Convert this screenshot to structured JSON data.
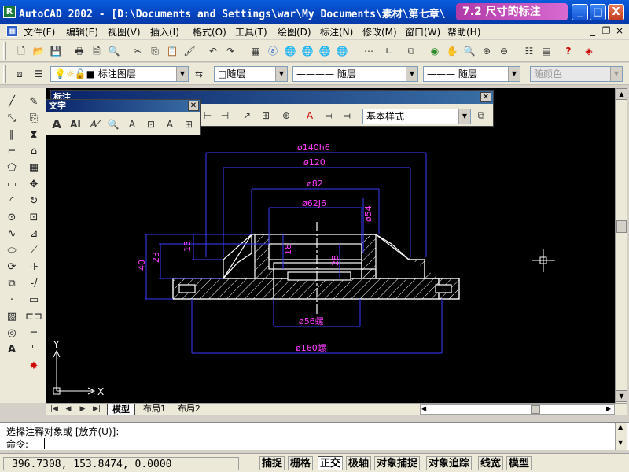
{
  "window": {
    "title": "AutoCAD 2002 - [D:\\Documents and Settings\\war\\My Documents\\素材\\第七章\\",
    "lesson_banner": "7.2 尺寸的标注",
    "app_icon": "R",
    "minimize": "_",
    "maximize": "□",
    "close": "X"
  },
  "menu": {
    "items": [
      "文件(F)",
      "编辑(E)",
      "视图(V)",
      "插入(I)",
      "格式(O)",
      "工具(T)",
      "绘图(D)",
      "标注(N)",
      "修改(M)",
      "窗口(W)",
      "帮助(H)"
    ],
    "mdi_min": "_",
    "mdi_restore": "❐",
    "mdi_close": "×"
  },
  "layer_bar": {
    "layer_name": "标注图层",
    "color": "□随层",
    "linetype": "———— 随层",
    "lineweight": "——— 随层",
    "plotstyle": "随颜色"
  },
  "dim_toolbar": {
    "title": "标注",
    "style": "基本样式"
  },
  "text_toolbar": {
    "title": "文字"
  },
  "drawing": {
    "dims": {
      "d140": "ø140h6",
      "d120": "ø120",
      "d82": "ø82",
      "d62": "ø62J6",
      "d54": "ø54",
      "d56": "ø56螺",
      "d160": "ø160螺",
      "h40": "40",
      "h23": "23",
      "h15": "15",
      "h18": "18",
      "h28": "28"
    },
    "ucs_x": "X",
    "ucs_y": "Y"
  },
  "tabs": [
    "模型",
    "布局1",
    "布局2"
  ],
  "command": {
    "history": "选择注释对象或 [放弃(U)]:",
    "prompt": "命令:"
  },
  "status": {
    "coords": "396.7308, 153.8474, 0.0000",
    "buttons": [
      "捕捉",
      "栅格",
      "正交",
      "极轴",
      "对象捕捉",
      "对象追踪",
      "线宽",
      "模型"
    ]
  },
  "colors": {
    "dim_blue": "#3c3cff",
    "dim_magenta": "#ff3cff",
    "geom_white": "#ffffff",
    "title_blue": "#0447c4"
  }
}
